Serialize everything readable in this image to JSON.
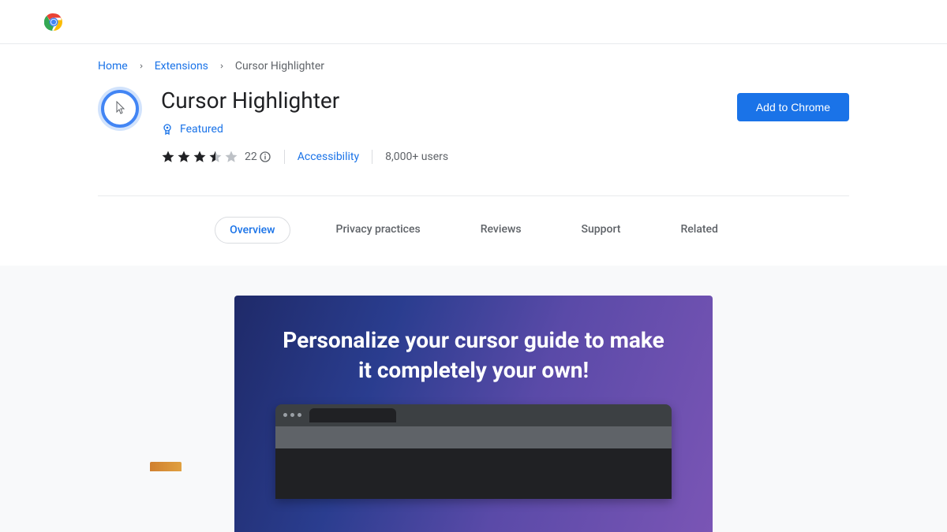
{
  "breadcrumbs": {
    "home": "Home",
    "extensions": "Extensions",
    "current": "Cursor Highlighter"
  },
  "extension": {
    "title": "Cursor Highlighter",
    "featured_label": "Featured",
    "rating_count": "22",
    "category": "Accessibility",
    "users": "8,000+ users"
  },
  "actions": {
    "add_to_chrome": "Add to Chrome"
  },
  "tabs": {
    "overview": "Overview",
    "privacy": "Privacy practices",
    "reviews": "Reviews",
    "support": "Support",
    "related": "Related"
  },
  "promo": {
    "headline": "Personalize your cursor guide to make it completely your own!"
  }
}
